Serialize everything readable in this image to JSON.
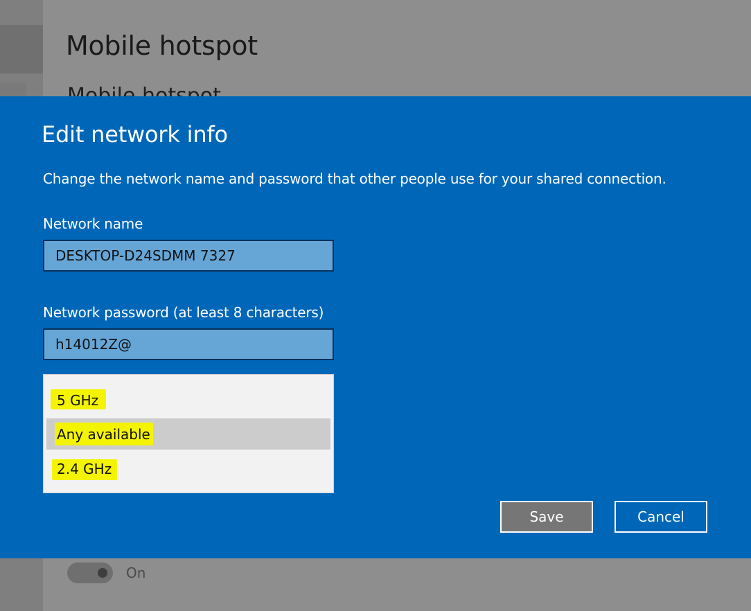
{
  "background": {
    "page_title": "Mobile hotspot",
    "section_title": "Mobile hotspot",
    "toggle_label": "On"
  },
  "dialog": {
    "title": "Edit network info",
    "description": "Change the network name and password that other people use for your shared connection.",
    "network_name_label": "Network name",
    "network_name_value": "DESKTOP-D24SDMM 7327",
    "password_label": "Network password (at least 8 characters)",
    "password_value": "h14012Z@",
    "band_options": [
      {
        "label": "5 GHz",
        "selected": false
      },
      {
        "label": "Any available",
        "selected": true
      },
      {
        "label": "2.4 GHz",
        "selected": false
      }
    ],
    "save_label": "Save",
    "cancel_label": "Cancel"
  },
  "colors": {
    "dialog_bg": "#0067b8",
    "highlight": "#f4f400",
    "input_bg": "#66a6d7"
  }
}
